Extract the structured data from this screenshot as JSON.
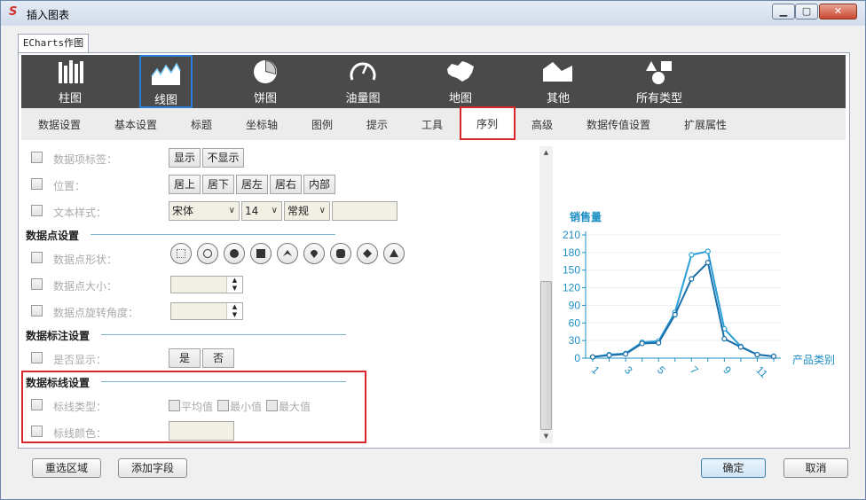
{
  "window": {
    "title": "插入图表"
  },
  "tab": {
    "label": "ECharts作图"
  },
  "chart_types": [
    {
      "label": "柱图",
      "icon": "bar-chart-icon"
    },
    {
      "label": "线图",
      "icon": "line-chart-icon",
      "selected": true
    },
    {
      "label": "饼图",
      "icon": "pie-chart-icon"
    },
    {
      "label": "油量图",
      "icon": "gauge-icon"
    },
    {
      "label": "地图",
      "icon": "map-icon"
    },
    {
      "label": "其他",
      "icon": "other-chart-icon"
    },
    {
      "label": "所有类型",
      "icon": "all-types-icon"
    }
  ],
  "sub_tabs": [
    "数据设置",
    "基本设置",
    "标题",
    "坐标轴",
    "图例",
    "提示",
    "工具",
    "序列",
    "高级",
    "数据传值设置",
    "扩展属性"
  ],
  "selected_sub_tab": "序列",
  "form": {
    "data_label": {
      "label": "数据项标签：",
      "show": "显示",
      "hide": "不显示"
    },
    "position": {
      "label": "位置：",
      "options": [
        "居上",
        "居下",
        "居左",
        "居右",
        "内部"
      ]
    },
    "text_style": {
      "label": "文本样式：",
      "font": "宋体",
      "size": "14",
      "weight": "常规"
    },
    "point_section": "数据点设置",
    "point_shape": {
      "label": "数据点形状："
    },
    "point_size": {
      "label": "数据点大小："
    },
    "point_rotate": {
      "label": "数据点旋转角度："
    },
    "mark_section": "数据标注设置",
    "mark_show": {
      "label": "是否显示：",
      "yes": "是",
      "no": "否"
    },
    "markline_section": "数据标线设置",
    "markline_type": {
      "label": "标线类型：",
      "options": [
        "平均值",
        "最小值",
        "最大值"
      ]
    },
    "markline_color": {
      "label": "标线颜色："
    }
  },
  "buttons": {
    "reselect": "重选区域",
    "add_field": "添加字段",
    "ok": "确定",
    "cancel": "取消"
  },
  "colors": {
    "accent": "#1d8fc4",
    "line1": "#2a9fd8",
    "line2": "#1c6fa8",
    "highlight": "#d9262a"
  },
  "chart_data": {
    "type": "line",
    "ylabel": "销售量",
    "xlabel": "产品类别",
    "ylim": [
      0,
      210
    ],
    "yticks": [
      0,
      30,
      60,
      90,
      120,
      150,
      180,
      210
    ],
    "x": [
      1,
      2,
      3,
      4,
      5,
      6,
      7,
      8,
      9,
      10,
      11,
      12
    ],
    "xtick_labels": [
      "1",
      "3",
      "5",
      "7",
      "9",
      "11"
    ],
    "series": [
      {
        "values": [
          2,
          6,
          8,
          27,
          29,
          78,
          176,
          182,
          50,
          20,
          6,
          3
        ]
      },
      {
        "values": [
          2,
          5,
          7,
          25,
          26,
          74,
          135,
          163,
          33,
          19,
          6,
          3
        ]
      }
    ]
  }
}
